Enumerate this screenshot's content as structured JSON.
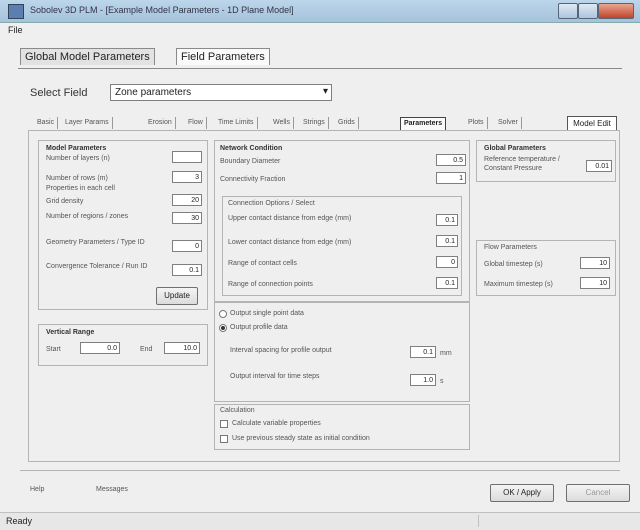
{
  "window": {
    "title": "Sobolev 3D PLM - [Example Model Parameters - 1D Plane Model]",
    "minimize_icon": "minimize-icon",
    "maximize_icon": "maximize-icon",
    "close_icon": "close-icon"
  },
  "menu": {
    "file": "File"
  },
  "main_tabs": [
    {
      "label": "Global Model Parameters",
      "active": false
    },
    {
      "label": "Field Parameters",
      "active": true
    }
  ],
  "select_field": {
    "label": "Select Field",
    "value": "Zone parameters"
  },
  "sub_tabs": [
    {
      "label": "Basic"
    },
    {
      "label": "Layer Params"
    },
    {
      "label": "Erosion"
    },
    {
      "label": "Flow"
    },
    {
      "label": "Time Limits"
    },
    {
      "label": "Wells"
    },
    {
      "label": "Strings"
    },
    {
      "label": "Grids"
    },
    {
      "label": "Parameters",
      "active": true
    },
    {
      "label": "Plots"
    },
    {
      "label": "Solver"
    }
  ],
  "extra_tab": "Model Edit",
  "model_params": {
    "title": "Model Parameters",
    "rows": [
      {
        "label": "Number of layers (n)",
        "value": ""
      },
      {
        "label": "Number of rows (m)",
        "value": "3"
      },
      {
        "label": "Properties in each cell",
        "value": ""
      },
      {
        "label": "Grid density",
        "value": "20"
      },
      {
        "label": "Number of regions / zones",
        "value": "30"
      },
      {
        "label": "Geometry Parameters / Type ID",
        "value": "0"
      },
      {
        "label": "Convergence Tolerance / Run ID",
        "value": "0.1"
      }
    ],
    "button": "Update"
  },
  "vertical_range": {
    "title": "Vertical Range",
    "start_label": "Start",
    "start_value": "0.0",
    "end_label": "End",
    "end_value": "10.0"
  },
  "network_condition": {
    "title": "Network Condition",
    "rows": [
      {
        "label": "Boundary Diameter",
        "value": "0.5"
      },
      {
        "label": "Connectivity Fraction",
        "value": "1"
      }
    ]
  },
  "connection_options": {
    "title": "Connection Options / Select",
    "rows": [
      {
        "label": "Upper contact distance from edge (mm)",
        "value": "0.1"
      },
      {
        "label": "Lower contact distance from edge (mm)",
        "value": "0.1"
      },
      {
        "label": "Range of contact cells",
        "value": "0"
      },
      {
        "label": "Range of connection points",
        "value": "0.1"
      }
    ]
  },
  "output_options": {
    "radio_1": "Output single point data",
    "radio_2": "Output profile data",
    "row_1": "Interval spacing for profile output",
    "row_1_value": "0.1",
    "row_1_unit": "mm",
    "row_2": "Output interval for time steps",
    "row_2_value": "1.0",
    "row_2_unit": "s"
  },
  "calculation": {
    "title": "Calculation",
    "check_1": "Calculate variable properties",
    "check_2": "Use previous steady state as initial condition"
  },
  "global_params": {
    "title": "Global Parameters",
    "label": "Reference temperature / Constant Pressure",
    "value": "0.01"
  },
  "flow_options": {
    "title": "Flow Parameters",
    "rows": [
      {
        "label": "Global timestep (s)",
        "value": "10"
      },
      {
        "label": "Maximum timestep (s)",
        "value": "10"
      }
    ]
  },
  "bottom": {
    "left_label": "Help",
    "mid_label": "Messages",
    "ok_button": "OK / Apply",
    "cancel_button": "Cancel"
  },
  "status": {
    "text": "Ready"
  }
}
